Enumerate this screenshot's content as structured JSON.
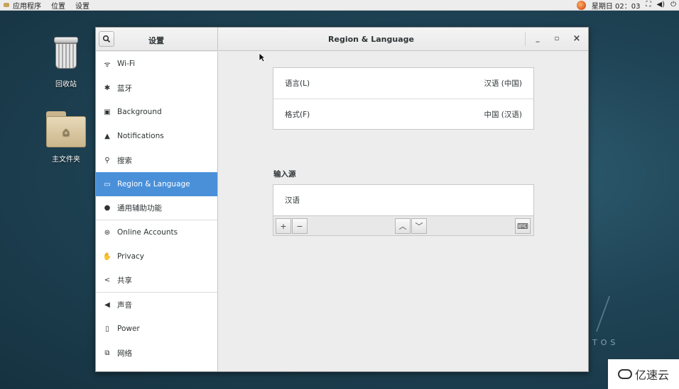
{
  "topbar": {
    "applications": "应用程序",
    "places": "位置",
    "settings": "设置",
    "clock": "星期日 02：03"
  },
  "desktop": {
    "trash_label": "回收站",
    "home_label": "主文件夹"
  },
  "window": {
    "sidebar_title": "设置",
    "title": "Region & Language",
    "minimize": "_",
    "maximize": "▫",
    "close": "×"
  },
  "sidebar": {
    "items": [
      {
        "label": "Wi-Fi",
        "icon": "wifi-icon"
      },
      {
        "label": "蓝牙",
        "icon": "bluetooth-icon"
      },
      {
        "label": "Background",
        "icon": "display-icon"
      },
      {
        "label": "Notifications",
        "icon": "bell-icon"
      },
      {
        "label": "搜索",
        "icon": "search-icon"
      },
      {
        "label": "Region & Language",
        "icon": "flag-icon",
        "active": true
      },
      {
        "label": "通用辅助功能",
        "icon": "accessibility-icon"
      },
      {
        "label": "Online Accounts",
        "icon": "online-accounts-icon"
      },
      {
        "label": "Privacy",
        "icon": "hand-icon"
      },
      {
        "label": "共享",
        "icon": "share-icon"
      },
      {
        "label": "声音",
        "icon": "speaker-icon"
      },
      {
        "label": "Power",
        "icon": "power-plug-icon"
      },
      {
        "label": "网络",
        "icon": "network-icon"
      }
    ]
  },
  "region": {
    "language_label": "语言(L)",
    "language_value": "汉语 (中国)",
    "formats_label": "格式(F)",
    "formats_value": "中国 (汉语)"
  },
  "input_sources": {
    "heading": "输入源",
    "items": [
      "汉语"
    ]
  },
  "watermark": {
    "os_text": "TOS",
    "brand_text": "亿速云"
  }
}
